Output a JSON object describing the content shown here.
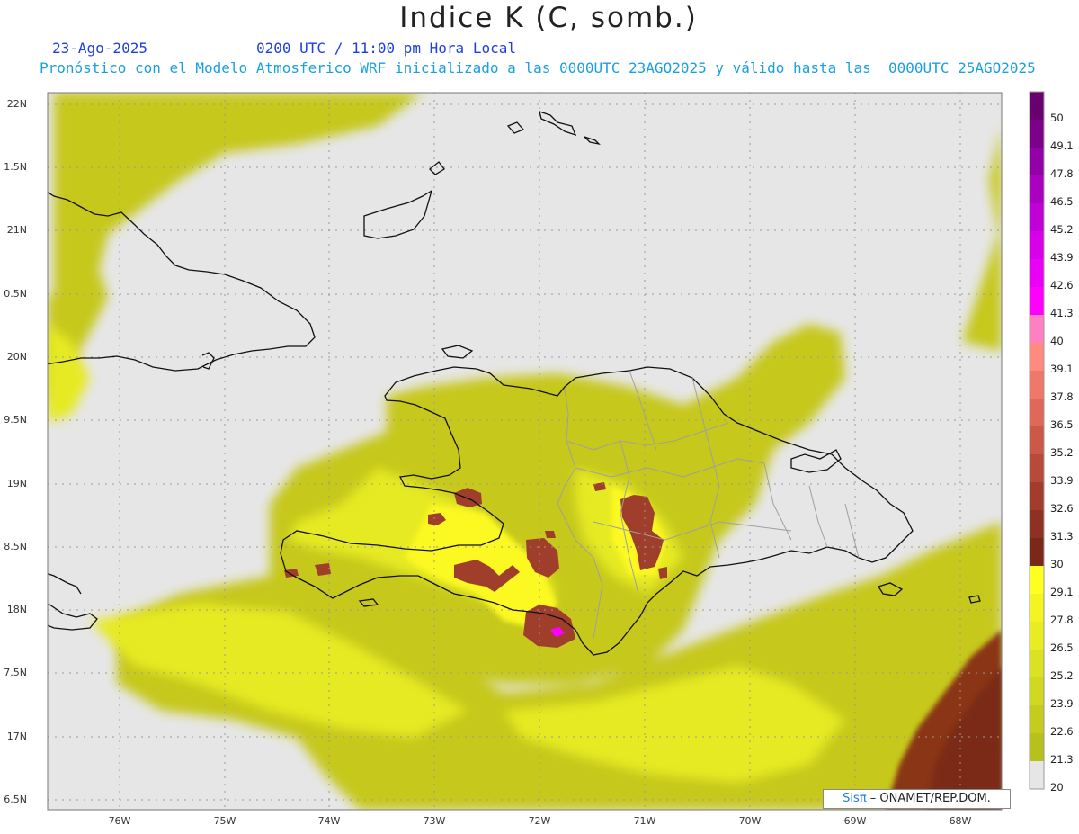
{
  "header": {
    "title": "Indice K (C, somb.)",
    "date": "23-Ago-2025",
    "time": "0200 UTC / 11:00 pm Hora Local",
    "model_line": "Pronóstico con el Modelo Atmosferico WRF inicializado a las 0000UTC_23AGO2025 y válido hasta las  0000UTC_25AGO2025"
  },
  "axes": {
    "lat_labels": [
      "22N",
      "1.5N",
      "21N",
      "0.5N",
      "20N",
      "9.5N",
      "19N",
      "8.5N",
      "18N",
      "7.5N",
      "17N",
      "6.5N"
    ],
    "lon_labels": [
      "76W",
      "75W",
      "74W",
      "73W",
      "72W",
      "71W",
      "70W",
      "69W",
      "68W"
    ]
  },
  "colorbar": {
    "labels": [
      "50",
      "49.1",
      "47.8",
      "46.5",
      "45.2",
      "43.9",
      "42.6",
      "41.3",
      "40",
      "39.1",
      "37.8",
      "36.5",
      "35.2",
      "33.9",
      "32.6",
      "31.3",
      "30",
      "29.1",
      "27.8",
      "26.5",
      "25.2",
      "23.9",
      "22.6",
      "21.3",
      "20"
    ],
    "colors": [
      "#6a006f",
      "#7d0088",
      "#9400a8",
      "#aa00c0",
      "#c000d6",
      "#d800e8",
      "#ea00f4",
      "#ff00ff",
      "#ff80c0",
      "#ff8a80",
      "#f07868",
      "#e06858",
      "#cc5848",
      "#b84a3a",
      "#a43c2e",
      "#8e3022",
      "#7a2818",
      "#ffff20",
      "#f4f420",
      "#e8ec20",
      "#dce222",
      "#d0d820",
      "#c4cc1e",
      "#b8c01c",
      "#e6e6e6"
    ]
  },
  "credit": {
    "sis": "Sis",
    "pi": "π",
    "rest": "– ONAMET/REP.DOM."
  },
  "colors": {
    "background": "#e6e6e6",
    "olive": "#c6c81e",
    "yellow": "#e8ec20",
    "bright_yellow": "#ffff20",
    "brown": "#a3402e",
    "dark_brown": "#8a3418"
  }
}
